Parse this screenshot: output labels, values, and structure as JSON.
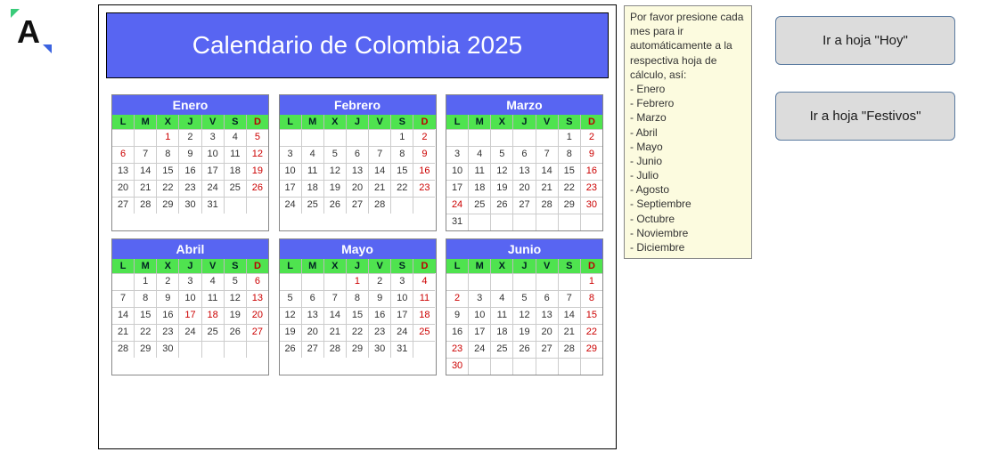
{
  "logo": {
    "letter": "A"
  },
  "title": "Calendario de Colombia 2025",
  "dow": [
    "L",
    "M",
    "X",
    "J",
    "V",
    "S",
    "D"
  ],
  "months": [
    {
      "name": "Enero",
      "rows": [
        [
          "",
          "",
          "1-r",
          "2",
          "3",
          "4",
          "5-r"
        ],
        [
          "6-r",
          "7",
          "8",
          "9",
          "10",
          "11",
          "12-r"
        ],
        [
          "13",
          "14",
          "15",
          "16",
          "17",
          "18",
          "19-r"
        ],
        [
          "20",
          "21",
          "22",
          "23",
          "24",
          "25",
          "26-r"
        ],
        [
          "27",
          "28",
          "29",
          "30",
          "31",
          "",
          ""
        ]
      ]
    },
    {
      "name": "Febrero",
      "rows": [
        [
          "",
          "",
          "",
          "",
          "",
          "1",
          "2-r"
        ],
        [
          "3",
          "4",
          "5",
          "6",
          "7",
          "8",
          "9-r"
        ],
        [
          "10",
          "11",
          "12",
          "13",
          "14",
          "15",
          "16-r"
        ],
        [
          "17",
          "18",
          "19",
          "20",
          "21",
          "22",
          "23-r"
        ],
        [
          "24",
          "25",
          "26",
          "27",
          "28",
          "",
          ""
        ]
      ]
    },
    {
      "name": "Marzo",
      "rows": [
        [
          "",
          "",
          "",
          "",
          "",
          "1",
          "2-r"
        ],
        [
          "3",
          "4",
          "5",
          "6",
          "7",
          "8",
          "9-r"
        ],
        [
          "10",
          "11",
          "12",
          "13",
          "14",
          "15",
          "16-r"
        ],
        [
          "17",
          "18",
          "19",
          "20",
          "21",
          "22",
          "23-r"
        ],
        [
          "24-r",
          "25",
          "26",
          "27",
          "28",
          "29",
          "30-r"
        ],
        [
          "31",
          "",
          "",
          "",
          "",
          "",
          ""
        ]
      ]
    },
    {
      "name": "Abril",
      "rows": [
        [
          "",
          "1",
          "2",
          "3",
          "4",
          "5",
          "6-r"
        ],
        [
          "7",
          "8",
          "9",
          "10",
          "11",
          "12",
          "13-r"
        ],
        [
          "14",
          "15",
          "16",
          "17-r",
          "18-r",
          "19",
          "20-r"
        ],
        [
          "21",
          "22",
          "23",
          "24",
          "25",
          "26",
          "27-r"
        ],
        [
          "28",
          "29",
          "30",
          "",
          "",
          "",
          ""
        ]
      ]
    },
    {
      "name": "Mayo",
      "rows": [
        [
          "",
          "",
          "",
          "1-r",
          "2",
          "3",
          "4-r"
        ],
        [
          "5",
          "6",
          "7",
          "8",
          "9",
          "10",
          "11-r"
        ],
        [
          "12",
          "13",
          "14",
          "15",
          "16",
          "17",
          "18-r"
        ],
        [
          "19",
          "20",
          "21",
          "22",
          "23",
          "24",
          "25-r"
        ],
        [
          "26",
          "27",
          "28",
          "29",
          "30",
          "31",
          ""
        ]
      ]
    },
    {
      "name": "Junio",
      "rows": [
        [
          "",
          "",
          "",
          "",
          "",
          "",
          "1-r"
        ],
        [
          "2-r",
          "3",
          "4",
          "5",
          "6",
          "7",
          "8-r"
        ],
        [
          "9",
          "10",
          "11",
          "12",
          "13",
          "14",
          "15-r"
        ],
        [
          "16",
          "17",
          "18",
          "19",
          "20",
          "21",
          "22-r"
        ],
        [
          "23-r",
          "24",
          "25",
          "26",
          "27",
          "28",
          "29-r"
        ],
        [
          "30-r",
          "",
          "",
          "",
          "",
          "",
          ""
        ]
      ]
    }
  ],
  "note": {
    "intro": "Por favor presione cada mes para ir automáticamente a la respectiva hoja de cálculo, así:",
    "items": [
      "Enero",
      "Febrero",
      "Marzo",
      "Abril",
      "Mayo",
      "Junio",
      "Julio",
      "Agosto",
      "Septiembre",
      "Octubre",
      "Noviembre",
      "Diciembre"
    ]
  },
  "buttons": {
    "hoy": "Ir a hoja \"Hoy\"",
    "festivos": "Ir a hoja \"Festivos\""
  }
}
